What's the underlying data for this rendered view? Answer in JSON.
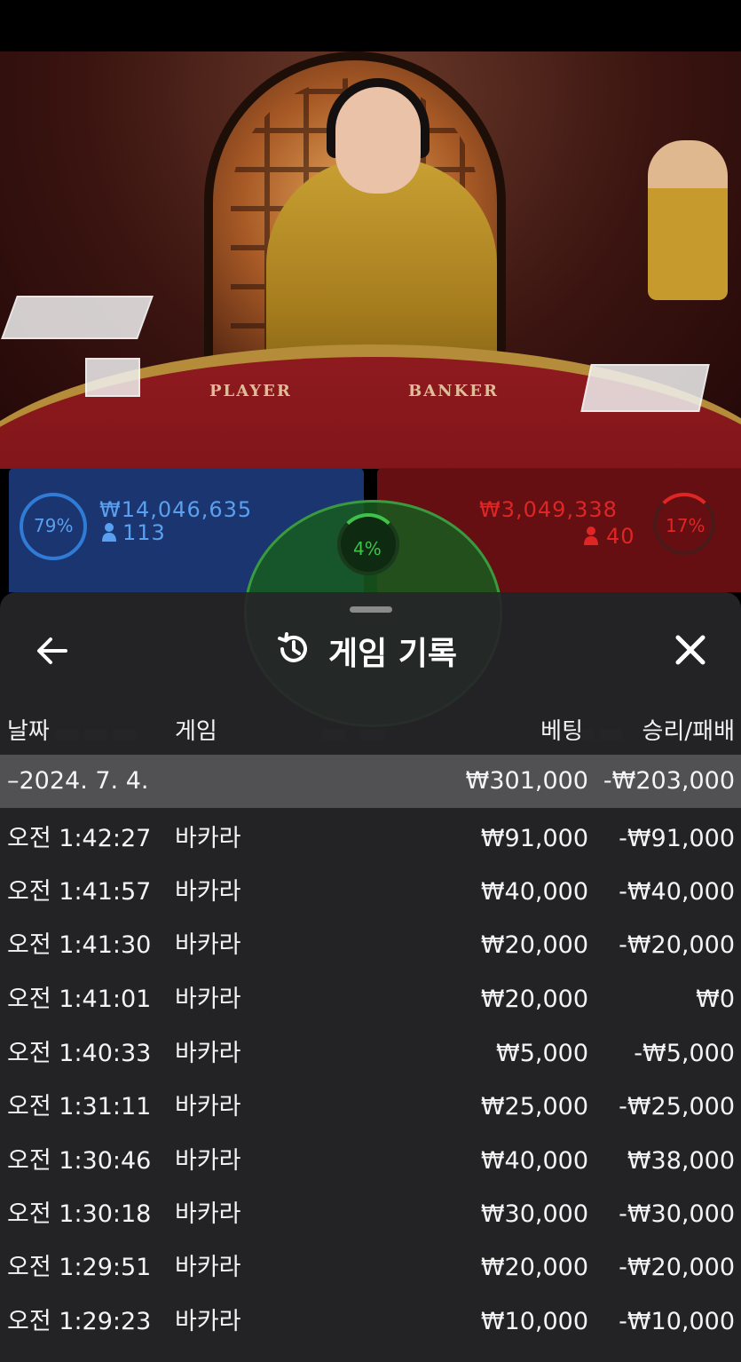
{
  "table": {
    "player_label": "PLAYER",
    "banker_label": "BANKER"
  },
  "bets": {
    "player": {
      "percent": "79%",
      "amount": "₩14,046,635",
      "players": "113",
      "color": "#2f7bd6"
    },
    "banker": {
      "percent": "17%",
      "amount": "₩3,049,338",
      "players": "40",
      "color": "#e02525"
    },
    "tie": {
      "percent": "4%",
      "color": "#3ec24a"
    }
  },
  "history": {
    "title": "게임 기록",
    "back_icon": "arrow-left-icon",
    "history_icon": "history-clock-icon",
    "close_icon": "close-icon",
    "columns": {
      "date": "날짜",
      "game": "게임",
      "bet": "베팅",
      "result": "승리/패배"
    },
    "date_group": {
      "date": "–2024. 7. 4.",
      "bet_total": "₩301,000",
      "result_total": "-₩203,000"
    },
    "rows": [
      {
        "time": "오전 1:42:27",
        "game": "바카라",
        "bet": "₩91,000",
        "result": "-₩91,000"
      },
      {
        "time": "오전 1:41:57",
        "game": "바카라",
        "bet": "₩40,000",
        "result": "-₩40,000"
      },
      {
        "time": "오전 1:41:30",
        "game": "바카라",
        "bet": "₩20,000",
        "result": "-₩20,000"
      },
      {
        "time": "오전 1:41:01",
        "game": "바카라",
        "bet": "₩20,000",
        "result": "₩0"
      },
      {
        "time": "오전 1:40:33",
        "game": "바카라",
        "bet": "₩5,000",
        "result": "-₩5,000"
      },
      {
        "time": "오전 1:31:11",
        "game": "바카라",
        "bet": "₩25,000",
        "result": "-₩25,000"
      },
      {
        "time": "오전 1:30:46",
        "game": "바카라",
        "bet": "₩40,000",
        "result": "₩38,000"
      },
      {
        "time": "오전 1:30:18",
        "game": "바카라",
        "bet": "₩30,000",
        "result": "-₩30,000"
      },
      {
        "time": "오전 1:29:51",
        "game": "바카라",
        "bet": "₩20,000",
        "result": "-₩20,000"
      },
      {
        "time": "오전 1:29:23",
        "game": "바카라",
        "bet": "₩10,000",
        "result": "-₩10,000"
      }
    ]
  }
}
